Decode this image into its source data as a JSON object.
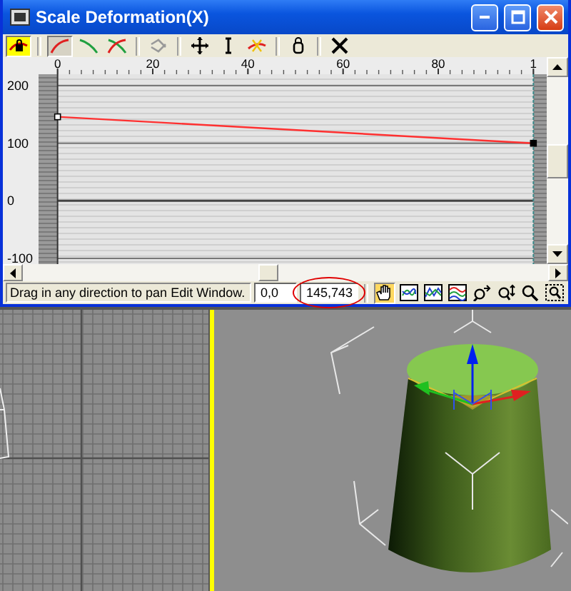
{
  "window": {
    "title": "Scale Deformation(X)"
  },
  "toolbar": [
    {
      "kind": "lock-curves",
      "selected": true
    },
    {
      "kind": "separator"
    },
    {
      "kind": "curve-x",
      "selected": true
    },
    {
      "kind": "curve-y",
      "selected": false
    },
    {
      "kind": "curve-xy",
      "selected": false
    },
    {
      "kind": "separator"
    },
    {
      "kind": "swap-curves",
      "selected": false
    },
    {
      "kind": "separator"
    },
    {
      "kind": "move-point",
      "selected": false
    },
    {
      "kind": "scale-point",
      "selected": false
    },
    {
      "kind": "insert-point",
      "selected": false
    },
    {
      "kind": "separator"
    },
    {
      "kind": "reset",
      "selected": false
    },
    {
      "kind": "separator"
    },
    {
      "kind": "delete",
      "selected": false
    }
  ],
  "graph": {
    "chart_data": {
      "type": "line",
      "x": [
        0,
        100
      ],
      "series": [
        {
          "color": "#ff3030",
          "marker": "square",
          "values": [
            146,
            100
          ]
        }
      ],
      "xlim": [
        -4,
        104
      ],
      "ylim": [
        -110,
        220
      ],
      "bands": [
        {
          "axis": "x",
          "from": -4,
          "to": 0
        },
        {
          "axis": "x",
          "from": 100,
          "to": 104
        }
      ],
      "ref_lines": [
        {
          "axis": "x",
          "value": 0
        },
        {
          "axis": "x",
          "value": 100
        }
      ],
      "grid": true,
      "xticks": [
        0,
        20,
        40,
        60,
        80
      ],
      "yticks": [
        200,
        100,
        0,
        {
          "value": -100,
          "label": "-100"
        }
      ]
    },
    "ruler_end_label": "1"
  },
  "status_bar": {
    "message": "Drag in any direction to pan Edit Window.",
    "fields": [
      {
        "value": "0,0",
        "circled": false
      },
      {
        "value": "145,743",
        "circled": true
      }
    ],
    "tools": [
      {
        "kind": "pan",
        "selected": true
      },
      {
        "kind": "zoom-extents",
        "selected": false
      },
      {
        "kind": "zoom-horizontal-extents",
        "selected": false
      },
      {
        "kind": "zoom-vertical-extents",
        "selected": false
      },
      {
        "kind": "zoom-horizontal",
        "selected": false
      },
      {
        "kind": "zoom-vertical",
        "selected": false
      },
      {
        "kind": "zoom",
        "selected": false
      },
      {
        "kind": "zoom-region",
        "selected": false
      }
    ]
  },
  "viewports": [
    {
      "kind": "grid",
      "active": false
    },
    {
      "kind": "perspective",
      "active": true
    }
  ]
}
